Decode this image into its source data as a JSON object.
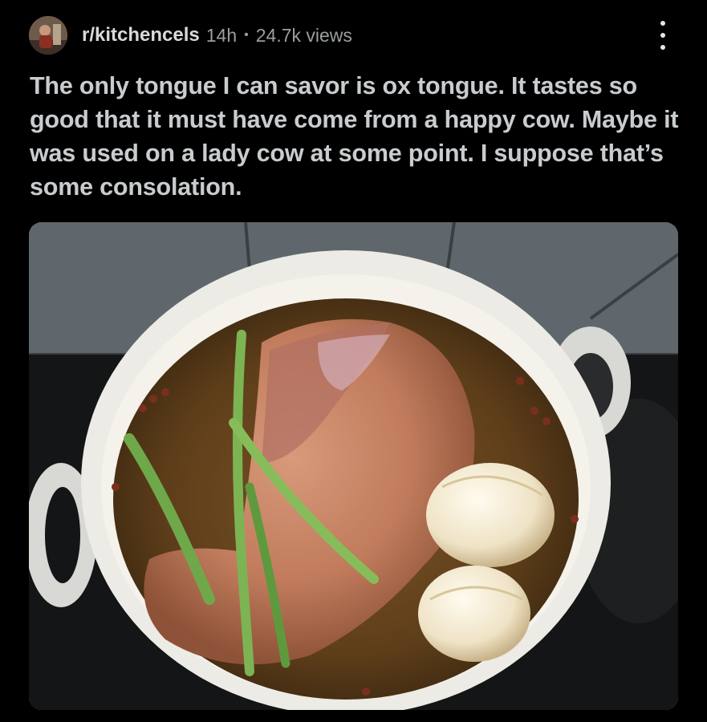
{
  "post": {
    "subreddit": "r/kitchencels",
    "age": "14h",
    "separator": "•",
    "views": "24.7k views",
    "title": "The only tongue I can savor is ox tongue. It tastes so good that it must have come from a happy cow. Maybe it was used on a lady cow at some point. I suppose that’s some consolation."
  },
  "icons": {
    "more": "more-vertical-icon"
  },
  "colors": {
    "background": "#000000",
    "title_text": "#c9cccf",
    "meta_text": "#9a9ea1"
  }
}
